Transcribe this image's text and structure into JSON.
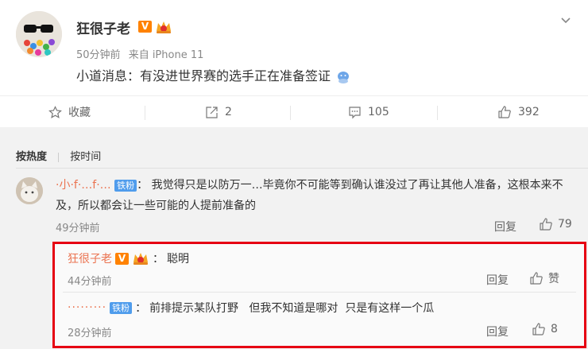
{
  "post": {
    "author": "狂很子老",
    "v_badge": "V",
    "time": "50分钟前",
    "source": "来自 iPhone 11",
    "text": "小道消息：有没进世界赛的选手正在准备签证"
  },
  "actions": {
    "favorite": "收藏",
    "repost": "2",
    "comments": "105",
    "likes": "392"
  },
  "sort": {
    "hot": "按热度",
    "time": "按时间"
  },
  "comment1": {
    "name": "·小·f·…f·…",
    "fan_badge": "铁粉",
    "text": "我觉得只是以防万一…毕竟你不可能等到确认谁没过了再让其他人准备，这根本来不及，所以都会让一些可能的人提前准备的",
    "time": "49分钟前",
    "reply": "回复",
    "likes": "79"
  },
  "reply1": {
    "name": "狂很子老",
    "v_badge": "V",
    "text": "聪明",
    "time": "44分钟前",
    "reply": "回复",
    "like": "赞"
  },
  "reply2": {
    "name": "·········",
    "fan_badge": "铁粉",
    "text": "前排提示某队打野   但我不知道是哪对  只是有这样一个瓜",
    "time": "28分钟前",
    "reply": "回复",
    "likes": "8"
  },
  "colors": {
    "accent": "#eb7350",
    "highlight_border": "#e60012",
    "fan_badge": "#4f9cec",
    "v_badge": "#ff8200"
  }
}
